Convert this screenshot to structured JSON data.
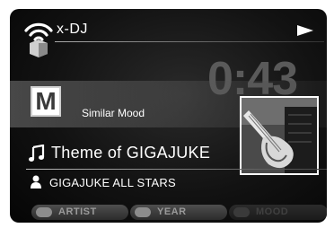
{
  "header": {
    "app_title": "x-DJ",
    "play_icon": "play-icon",
    "logo_icon": "wireless-speaker-icon"
  },
  "playback": {
    "elapsed": "0:43"
  },
  "mood": {
    "badge_letter": "M",
    "label": "Similar Mood"
  },
  "track": {
    "title": "Theme of GIGAJUKE",
    "artist": "GIGAJUKE ALL STARS"
  },
  "filters": [
    {
      "label": "ARTIST",
      "active": true
    },
    {
      "label": "YEAR",
      "active": true
    },
    {
      "label": "MOOD",
      "active": false
    }
  ],
  "colors": {
    "background": "#000000",
    "text": "#ffffff",
    "time": "#5a5a5a"
  }
}
